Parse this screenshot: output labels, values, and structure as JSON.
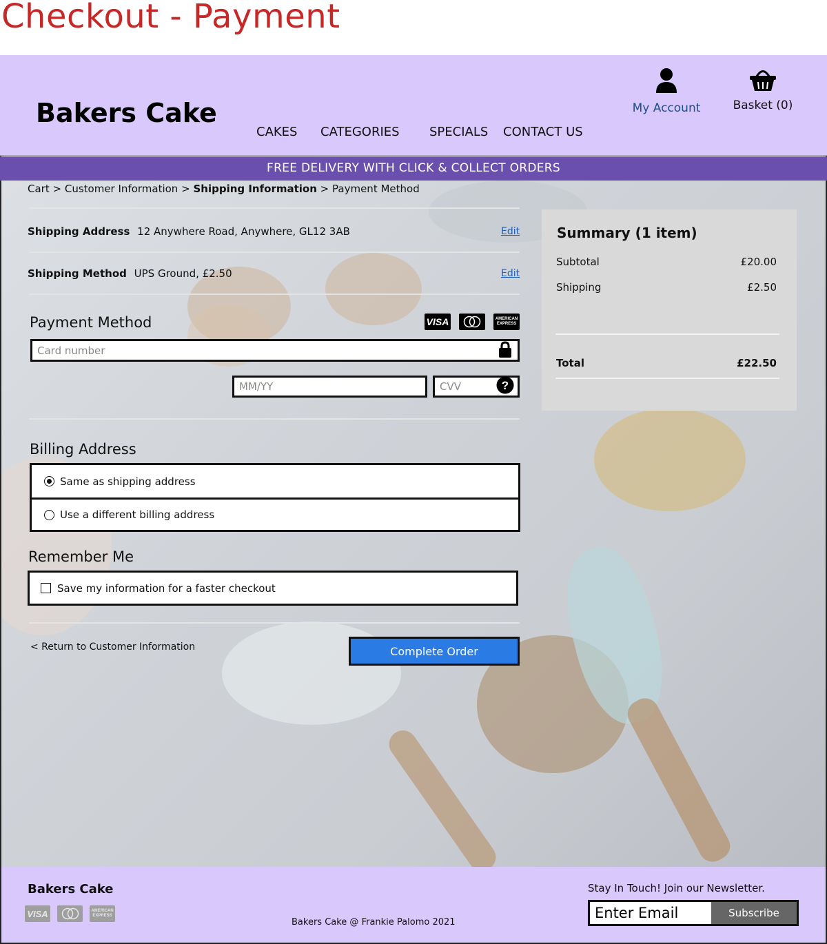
{
  "page_heading": "Checkout - Payment",
  "header": {
    "brand": "Bakers Cake",
    "nav": [
      "CAKES",
      "CATEGORIES",
      "SPECIALS",
      "CONTACT US"
    ],
    "account_label": "My Account",
    "basket_label": "Basket (0)",
    "account_icon": "user-icon",
    "basket_icon": "basket-icon"
  },
  "promo": "FREE DELIVERY WITH CLICK & COLLECT ORDERS",
  "breadcrumb": {
    "cart": "Cart",
    "sep": ">",
    "customer_info": "Customer Information",
    "shipping_info": "Shipping Information",
    "payment_method": "Payment Method"
  },
  "shipping": {
    "address_label": "Shipping Address",
    "address_value": "12 Anywhere Road, Anywhere, GL12 3AB",
    "method_label": "Shipping Method",
    "method_value": "UPS Ground, £2.50",
    "edit_label": "Edit"
  },
  "payment": {
    "title": "Payment Method",
    "cards": [
      "VISA",
      "mastercard",
      "AMERICAN EXPRESS"
    ],
    "card_number_placeholder": "Card number",
    "expiry_placeholder": "MM/YY",
    "cvv_placeholder": "CVV"
  },
  "billing": {
    "title": "Billing Address",
    "option_same": "Same as shipping address",
    "option_different": "Use a different billing address",
    "selected": "same"
  },
  "remember": {
    "title": "Remember Me",
    "checkbox_label": "Save my information for a faster checkout",
    "checked": false
  },
  "actions": {
    "return_label": "< Return to Customer Information",
    "complete_label": "Complete Order"
  },
  "summary": {
    "title": "Summary (1 item)",
    "subtotal_label": "Subtotal",
    "subtotal_value": "£20.00",
    "shipping_label": "Shipping",
    "shipping_value": "£2.50",
    "total_label": "Total",
    "total_value": "£22.50"
  },
  "footer": {
    "brand": "Bakers Cake",
    "copyright": "Bakers Cake @ Frankie Palomo 2021",
    "newsletter_label": "Stay In Touch! Join our Newsletter.",
    "email_placeholder": "Enter Email",
    "subscribe_label": "Subscribe"
  },
  "colors": {
    "header_bg": "#d8c8fc",
    "promo_bg": "#6a4faf",
    "heading": "#c62828",
    "primary_button": "#2b7be4",
    "account_link": "#1f4e8c"
  }
}
